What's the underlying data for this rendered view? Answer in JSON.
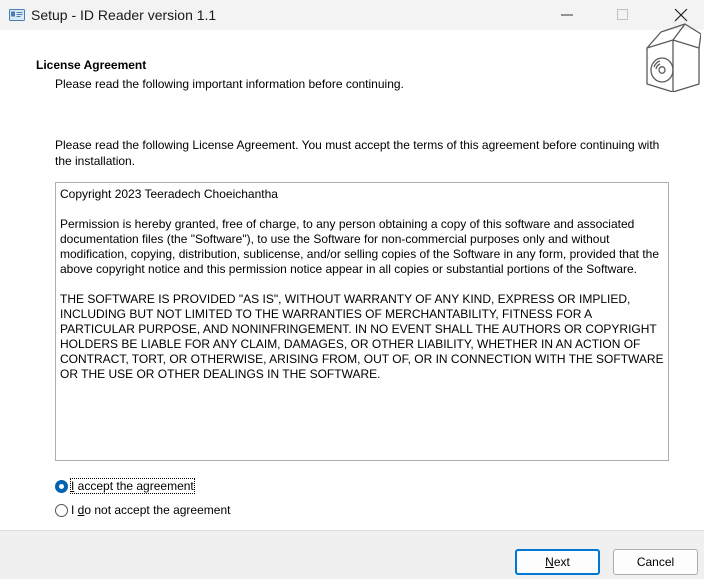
{
  "window": {
    "title": "Setup - ID Reader version 1.1",
    "controls": {
      "minimize": "—",
      "maximize": "☐",
      "close": "✕"
    }
  },
  "header": {
    "title": "License Agreement",
    "subtitle": "Please read the following important information before continuing.",
    "icon": "software-box-icon"
  },
  "intro": "Please read the following License Agreement. You must accept the terms of this agreement before continuing with the installation.",
  "license": {
    "paragraphs": [
      "Copyright 2023 Teeradech Choeichantha",
      "Permission is hereby granted, free of charge, to any person obtaining a copy of this software and associated documentation files (the \"Software\"), to use the Software for non-commercial purposes only and without modification, copying, distribution, sublicense, and/or selling copies of the Software in any form, provided that the above copyright notice and this permission notice appear in all copies or substantial portions of the Software.",
      "THE SOFTWARE IS PROVIDED \"AS IS\", WITHOUT WARRANTY OF ANY KIND, EXPRESS OR IMPLIED, INCLUDING BUT NOT LIMITED TO THE WARRANTIES OF MERCHANTABILITY, FITNESS FOR A PARTICULAR PURPOSE, AND NONINFRINGEMENT. IN NO EVENT SHALL THE AUTHORS OR COPYRIGHT HOLDERS BE LIABLE FOR ANY CLAIM, DAMAGES, OR OTHER LIABILITY, WHETHER IN AN ACTION OF CONTRACT, TORT, OR OTHERWISE, ARISING FROM, OUT OF, OR IN CONNECTION WITH THE SOFTWARE OR THE USE OR OTHER DEALINGS IN THE SOFTWARE."
    ]
  },
  "options": {
    "accept": {
      "label_pre": "",
      "label_accel": "I",
      "label_post": " accept the agreement",
      "selected": true
    },
    "decline": {
      "label_pre": "I ",
      "label_accel": "d",
      "label_post": "o not accept the agreement",
      "selected": false
    }
  },
  "buttons": {
    "next": {
      "label_accel": "N",
      "label_post": "ext"
    },
    "cancel": {
      "label": "Cancel"
    }
  },
  "colors": {
    "accent": "#0078d4",
    "radio_selected": "#0063b1"
  }
}
